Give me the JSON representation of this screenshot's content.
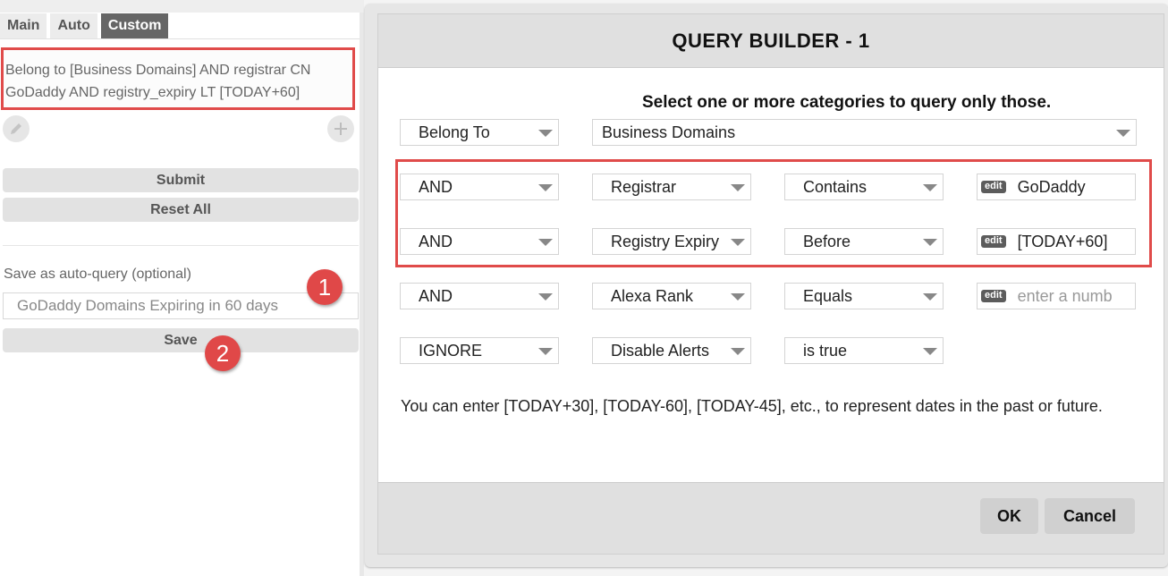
{
  "left_panel": {
    "tabs": [
      {
        "label": "Main",
        "active": false
      },
      {
        "label": "Auto",
        "active": false
      },
      {
        "label": "Custom",
        "active": true
      }
    ],
    "query_summary": "Belong to [Business Domains] AND registrar CN GoDaddy AND registry_expiry LT [TODAY+60]",
    "icons": {
      "edit": "pencil-icon",
      "add": "plus-icon"
    },
    "submit_label": "Submit",
    "reset_label": "Reset All",
    "save_as_label": "Save as auto-query (optional)",
    "save_name_value": "GoDaddy Domains Expiring in 60 days",
    "save_label": "Save",
    "badges": [
      "1",
      "2"
    ]
  },
  "modal": {
    "title": "QUERY BUILDER - 1",
    "subtitle": "Select one or more categories to query only those.",
    "category_row": {
      "type": "Belong To",
      "category": "Business Domains"
    },
    "rows": [
      {
        "logic": "AND",
        "field": "Registrar",
        "operator": "Contains",
        "value": "GoDaddy",
        "placeholder": ""
      },
      {
        "logic": "AND",
        "field": "Registry Expiry",
        "operator": "Before",
        "value": "[TODAY+60]",
        "placeholder": ""
      },
      {
        "logic": "AND",
        "field": "Alexa Rank",
        "operator": "Equals",
        "value": "",
        "placeholder": "enter a numb"
      },
      {
        "logic": "IGNORE",
        "field": "Disable Alerts",
        "operator": "is true"
      }
    ],
    "edit_tag": "edit",
    "hint": "You can enter [TODAY+30], [TODAY-60], [TODAY-45], etc., to represent dates in the past or future.",
    "ok_label": "OK",
    "cancel_label": "Cancel"
  },
  "colors": {
    "highlight": "#e04b4a",
    "badge": "#e04848",
    "active_tab": "#666666"
  }
}
